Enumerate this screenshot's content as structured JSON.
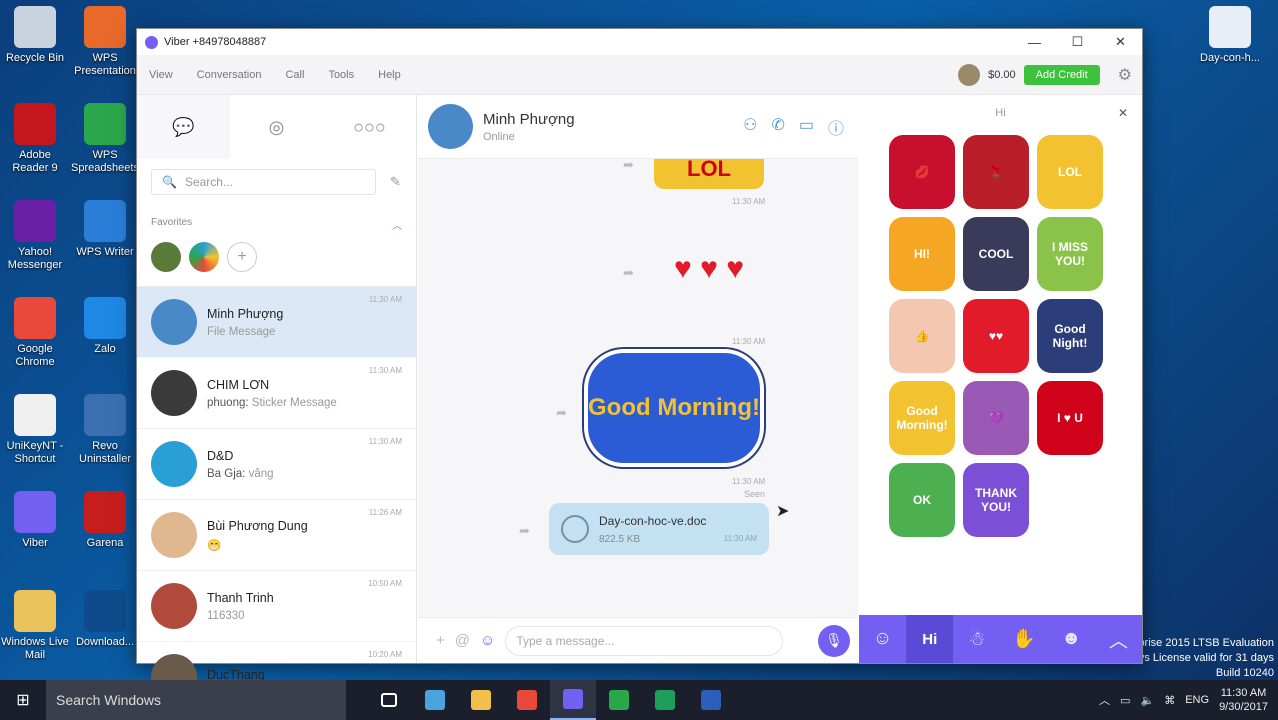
{
  "desktop": {
    "icons": [
      {
        "label": "Recycle Bin",
        "color": "#c9d3de"
      },
      {
        "label": "WPS Presentation",
        "color": "#e8692a"
      },
      {
        "label": "Adobe Reader 9",
        "color": "#c4161c"
      },
      {
        "label": "WPS Spreadsheets",
        "color": "#2aa74a"
      },
      {
        "label": "Yahoo! Messenger",
        "color": "#6b1fa7"
      },
      {
        "label": "WPS Writer",
        "color": "#2a7ed8"
      },
      {
        "label": "Google Chrome",
        "color": "#e8493a"
      },
      {
        "label": "Zalo",
        "color": "#1e88e5"
      },
      {
        "label": "UniKeyNT - Shortcut",
        "color": "#f0f0f0"
      },
      {
        "label": "Revo Uninstaller",
        "color": "#3a6fb0"
      },
      {
        "label": "Viber",
        "color": "#7360f2"
      },
      {
        "label": "Garena",
        "color": "#c81d1d"
      },
      {
        "label": "Windows Live Mail",
        "color": "#e9c25a"
      },
      {
        "label": "Download...",
        "color": "#0f4b8c"
      },
      {
        "label": "Day-con-h...",
        "color": "#e8eef8"
      }
    ],
    "eval_lines": [
      "rprise 2015 LTSB Evaluation",
      "vs License valid for 31 days",
      "Build 10240"
    ]
  },
  "window": {
    "title": "Viber +84978048887",
    "menu": [
      "View",
      "Conversation",
      "Call",
      "Tools",
      "Help"
    ],
    "balance": "$0.00",
    "add_credit": "Add Credit"
  },
  "sidebar": {
    "search_placeholder": "Search...",
    "favorites_label": "Favorites",
    "contacts": [
      {
        "name": "Minh Phượng",
        "sender": "",
        "preview": "File Message",
        "time": "11:30 AM",
        "color": "#4a89c7"
      },
      {
        "name": "CHIM LƠN",
        "sender": "phuong:",
        "preview": "Sticker Message",
        "time": "11:30 AM",
        "color": "#3a3a3a"
      },
      {
        "name": "D&D",
        "sender": "Ba Gja:",
        "preview": "vâng",
        "time": "11:30 AM",
        "color": "#2a9fd6"
      },
      {
        "name": "Bùi Phương Dung",
        "sender": "",
        "preview": "😁",
        "time": "11:26 AM",
        "color": "#e0b890"
      },
      {
        "name": "Thanh Trinh",
        "sender": "",
        "preview": "116330",
        "time": "10:50 AM",
        "color": "#b04a3a"
      },
      {
        "name": "DucThang",
        "sender": "",
        "preview": "",
        "time": "10:20 AM",
        "color": "#6a5a4a"
      }
    ]
  },
  "chat": {
    "contact_name": "Minh Phượng",
    "status": "Online",
    "messages": [
      {
        "sticker": "LOL",
        "time": "11:30 AM"
      },
      {
        "sticker": "♥ ♥ ♥",
        "time": "11:30 AM"
      },
      {
        "sticker": "Good Morning!",
        "time": "11:30 AM",
        "seen": "Seen"
      }
    ],
    "file": {
      "name": "Day-con-hoc-ve.doc",
      "size": "822.5 KB",
      "time": "11:30 AM"
    },
    "input_placeholder": "Type a message..."
  },
  "sticker_panel": {
    "title": "Hi",
    "stickers": [
      {
        "label": "💋",
        "color": "#c8102e"
      },
      {
        "label": "🌹",
        "color": "#b81f2a"
      },
      {
        "label": "LOL",
        "color": "#f2c230"
      },
      {
        "label": "HI!",
        "color": "#f5a623"
      },
      {
        "label": "COOL",
        "color": "#3a3a5a"
      },
      {
        "label": "I MISS YOU!",
        "color": "#8bc34a"
      },
      {
        "label": "👍",
        "color": "#f4c8b0"
      },
      {
        "label": "♥♥",
        "color": "#e21b2a"
      },
      {
        "label": "Good Night!",
        "color": "#2c3e7a"
      },
      {
        "label": "Good Morning!",
        "color": "#f2c230"
      },
      {
        "label": "💜",
        "color": "#9b59b6"
      },
      {
        "label": "I ♥ U",
        "color": "#d0021b"
      },
      {
        "label": "OK",
        "color": "#4caf50"
      },
      {
        "label": "THANK YOU!",
        "color": "#7b4fd6"
      }
    ],
    "tabs": [
      "☺",
      "Hi",
      "☃",
      "✋",
      "☻",
      "︿"
    ]
  },
  "taskbar": {
    "search_text": "Search Windows",
    "apps": [
      {
        "name": "task-view",
        "color": "#ffffff"
      },
      {
        "name": "app-1",
        "color": "#4aa3df"
      },
      {
        "name": "file-explorer",
        "color": "#f2c04a"
      },
      {
        "name": "chrome",
        "color": "#e8493a"
      },
      {
        "name": "viber",
        "color": "#7360f2"
      },
      {
        "name": "wps-spreadsheet",
        "color": "#2aa74a"
      },
      {
        "name": "app-green",
        "color": "#1e9e5a"
      },
      {
        "name": "word",
        "color": "#2a5eb8"
      }
    ],
    "language": "ENG",
    "time": "11:30 AM",
    "date": "9/30/2017"
  }
}
